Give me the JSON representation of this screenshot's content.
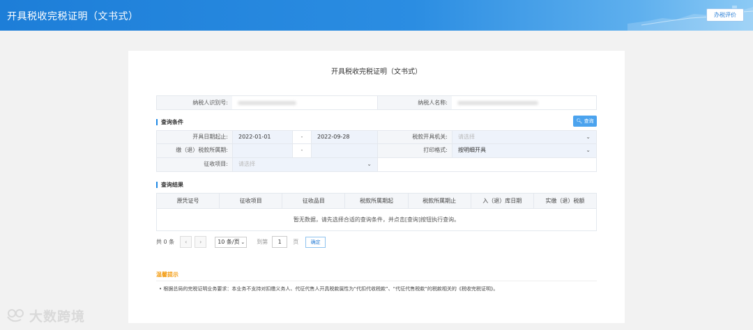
{
  "header": {
    "title": "开具税收完税证明（文书式）",
    "eval_button": "办税评价"
  },
  "card": {
    "title": "开具税收完税证明（文书式）"
  },
  "taxpayer": {
    "id_label": "纳税人识别号:",
    "name_label": "纳税人名称:"
  },
  "query": {
    "section_title": "查询条件",
    "query_button": "查询",
    "date_range_label": "开具日期起止:",
    "date_start": "2022-01-01",
    "date_sep": "-",
    "date_end": "2022-09-28",
    "authority_label": "税款开具机关:",
    "authority_placeholder": "请选择",
    "period_label": "缴（退）税款所属期:",
    "period_sep": "-",
    "print_format_label": "打印格式:",
    "print_format_value": "按明细开具",
    "levy_label": "征收项目:",
    "levy_placeholder": "请选择"
  },
  "results": {
    "section_title": "查询结果",
    "columns": [
      "原凭证号",
      "征收项目",
      "征收品目",
      "税款所属期起",
      "税款所属期止",
      "入（退）库日期",
      "实缴（退）税额"
    ],
    "empty_text": "暂无数据，请先选择合适的查询条件，并点击[查询]按钮执行查询。"
  },
  "pager": {
    "total": "共 0 条",
    "page_size": "10 条/页",
    "goto_label": "到第",
    "page_value": "1",
    "page_suffix": "页",
    "confirm": "确定"
  },
  "tips": {
    "title": "温馨提示",
    "text": "• 根据总局的完税证明业务要求：本业务不支持对扣缴义务人、代征代售人开具税款属性为“代扣代收税款”、“代征代售税款”的税款相关的《税收完税证明》。"
  },
  "watermark": "大数跨境",
  "colors": {
    "header": "#2088dc",
    "accent": "#4ba3ee",
    "tip": "#f39c12"
  }
}
